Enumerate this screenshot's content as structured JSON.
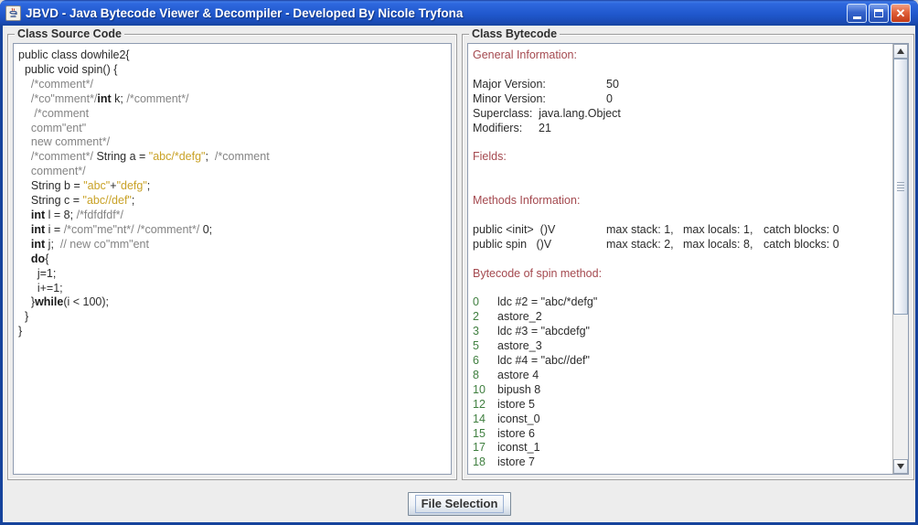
{
  "window": {
    "title": "JBVD - Java Bytecode Viewer & Decompiler - Developed By Nicole Tryfona",
    "controls": {
      "minimize": "minimize",
      "maximize": "maximize",
      "close": "close"
    }
  },
  "colors": {
    "titlebar_blue": "#2058cd",
    "frame_blue": "#16439C",
    "comment_gray": "#848484",
    "string_gold": "#C9A227",
    "header_red": "#A4494F",
    "offset_green": "#3F7F3F",
    "panel_bg": "#EDEDED"
  },
  "source_panel": {
    "title": "Class Source Code",
    "lines": [
      [
        {
          "c": "code",
          "t": "public class dowhile2{"
        }
      ],
      [
        {
          "c": "code",
          "t": "  public void spin() {"
        }
      ],
      [
        {
          "c": "cm",
          "t": "    /*comment*/"
        }
      ],
      [
        {
          "c": "cm",
          "t": "    /*co\"mment*/"
        },
        {
          "c": "kw",
          "t": "int"
        },
        {
          "c": "code",
          "t": " k; "
        },
        {
          "c": "cm",
          "t": "/*comment*/"
        }
      ],
      [
        {
          "c": "cm",
          "t": "     /*comment"
        }
      ],
      [
        {
          "c": "cm",
          "t": "    comm\"ent\""
        }
      ],
      [
        {
          "c": "cm",
          "t": "    new comment*/"
        }
      ],
      [
        {
          "c": "cm",
          "t": "    /*comment*/"
        },
        {
          "c": "code",
          "t": " String a = "
        },
        {
          "c": "str",
          "t": "\"abc/*defg\""
        },
        {
          "c": "code",
          "t": ";  "
        },
        {
          "c": "cm",
          "t": "/*comment"
        }
      ],
      [
        {
          "c": "cm",
          "t": "    comment*/"
        }
      ],
      [
        {
          "c": "code",
          "t": "    String b = "
        },
        {
          "c": "str",
          "t": "\"abc\""
        },
        {
          "c": "code",
          "t": "+"
        },
        {
          "c": "str",
          "t": "\"defg\""
        },
        {
          "c": "code",
          "t": ";"
        }
      ],
      [
        {
          "c": "code",
          "t": "    String c = "
        },
        {
          "c": "str",
          "t": "\"abc//def\""
        },
        {
          "c": "code",
          "t": ";"
        }
      ],
      [
        {
          "c": "code",
          "t": "    "
        },
        {
          "c": "kw",
          "t": "int"
        },
        {
          "c": "code",
          "t": " l = 8; "
        },
        {
          "c": "cm",
          "t": "/*fdfdfdf*/"
        }
      ],
      [
        {
          "c": "code",
          "t": "    "
        },
        {
          "c": "kw",
          "t": "int"
        },
        {
          "c": "code",
          "t": " i = "
        },
        {
          "c": "cm",
          "t": "/*com\"me\"nt*/"
        },
        {
          "c": "code",
          "t": " "
        },
        {
          "c": "cm",
          "t": "/*comment*/"
        },
        {
          "c": "code",
          "t": " 0;"
        }
      ],
      [
        {
          "c": "code",
          "t": "    "
        },
        {
          "c": "kw",
          "t": "int"
        },
        {
          "c": "code",
          "t": " j;  "
        },
        {
          "c": "cm",
          "t": "// new co\"mm\"ent"
        }
      ],
      [
        {
          "c": "code",
          "t": "    "
        },
        {
          "c": "kw",
          "t": "do"
        },
        {
          "c": "code",
          "t": "{"
        }
      ],
      [
        {
          "c": "code",
          "t": "      j=1;"
        }
      ],
      [
        {
          "c": "code",
          "t": "      i+=1;"
        }
      ],
      [
        {
          "c": "code",
          "t": "    }"
        },
        {
          "c": "kw",
          "t": "while"
        },
        {
          "c": "code",
          "t": "(i < 100);"
        }
      ],
      [
        {
          "c": "code",
          "t": "  }"
        }
      ],
      [
        {
          "c": "code",
          "t": "}"
        }
      ]
    ]
  },
  "bytecode_panel": {
    "title": "Class Bytecode",
    "lines": [
      [
        {
          "c": "hdr",
          "t": "General Information:"
        }
      ],
      [],
      [
        {
          "c": "code",
          "t": "Major Version:",
          "w": 146
        },
        {
          "c": "code",
          "t": "50"
        }
      ],
      [
        {
          "c": "code",
          "t": "Minor Version:",
          "w": 146
        },
        {
          "c": "code",
          "t": "0"
        }
      ],
      [
        {
          "c": "code",
          "t": "Superclass:  java.lang.Object"
        }
      ],
      [
        {
          "c": "code",
          "t": "Modifiers:",
          "w": 72
        },
        {
          "c": "code",
          "t": "21"
        }
      ],
      [],
      [
        {
          "c": "hdr",
          "t": "Fields:"
        }
      ],
      [],
      [],
      [
        {
          "c": "hdr",
          "t": "Methods Information:"
        }
      ],
      [],
      [
        {
          "c": "code",
          "t": "public <init>  ()V",
          "w": 146
        },
        {
          "c": "code",
          "t": "max stack: 1,",
          "w": 84
        },
        {
          "c": "code",
          "t": "max locals: 1,",
          "w": 88
        },
        {
          "c": "code",
          "t": "catch blocks: 0"
        }
      ],
      [
        {
          "c": "code",
          "t": "public spin   ()V",
          "w": 146
        },
        {
          "c": "code",
          "t": "max stack: 2,",
          "w": 84
        },
        {
          "c": "code",
          "t": "max locals: 8,",
          "w": 88
        },
        {
          "c": "code",
          "t": "catch blocks: 0"
        }
      ],
      [],
      [
        {
          "c": "hdr",
          "t": "Bytecode of spin method:"
        }
      ],
      [],
      [
        {
          "c": "off",
          "t": "0",
          "w": 27
        },
        {
          "c": "code",
          "t": "ldc #2 = \"abc/*defg\""
        }
      ],
      [
        {
          "c": "off",
          "t": "2",
          "w": 27
        },
        {
          "c": "code",
          "t": "astore_2"
        }
      ],
      [
        {
          "c": "off",
          "t": "3",
          "w": 27
        },
        {
          "c": "code",
          "t": "ldc #3 = \"abcdefg\""
        }
      ],
      [
        {
          "c": "off",
          "t": "5",
          "w": 27
        },
        {
          "c": "code",
          "t": "astore_3"
        }
      ],
      [
        {
          "c": "off",
          "t": "6",
          "w": 27
        },
        {
          "c": "code",
          "t": "ldc #4 = \"abc//def\""
        }
      ],
      [
        {
          "c": "off",
          "t": "8",
          "w": 27
        },
        {
          "c": "code",
          "t": "astore 4"
        }
      ],
      [
        {
          "c": "off",
          "t": "10",
          "w": 27
        },
        {
          "c": "code",
          "t": "bipush 8"
        }
      ],
      [
        {
          "c": "off",
          "t": "12",
          "w": 27
        },
        {
          "c": "code",
          "t": "istore 5"
        }
      ],
      [
        {
          "c": "off",
          "t": "14",
          "w": 27
        },
        {
          "c": "code",
          "t": "iconst_0"
        }
      ],
      [
        {
          "c": "off",
          "t": "15",
          "w": 27
        },
        {
          "c": "code",
          "t": "istore 6"
        }
      ],
      [
        {
          "c": "off",
          "t": "17",
          "w": 27
        },
        {
          "c": "code",
          "t": "iconst_1"
        }
      ],
      [
        {
          "c": "off",
          "t": "18",
          "w": 27
        },
        {
          "c": "code",
          "t": "istore 7"
        }
      ]
    ]
  },
  "footer": {
    "button_label": "File Selection"
  }
}
